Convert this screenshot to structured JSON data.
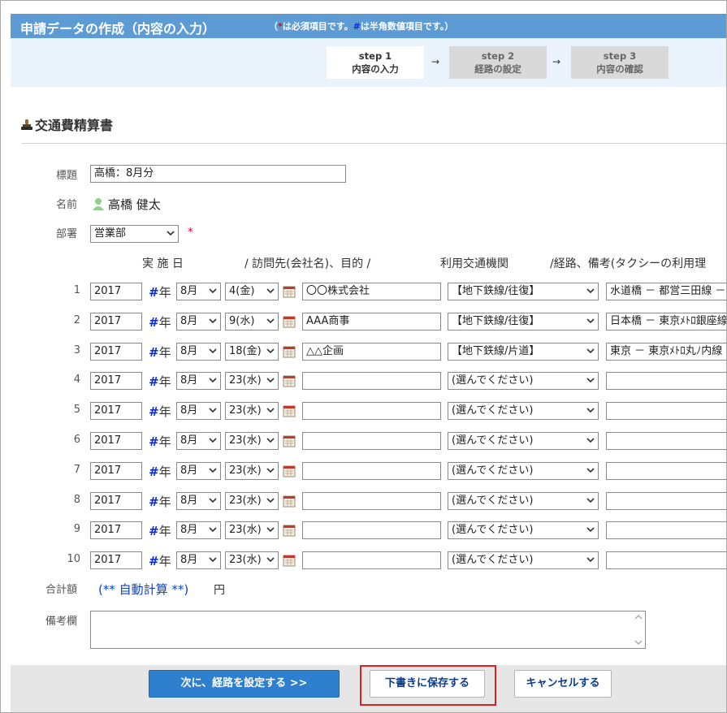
{
  "header": {
    "title": "申請データの作成（内容の入力）",
    "note_open": "（",
    "note_red_mark": "*",
    "note_mid": "は必須項目です。",
    "note_blue_mark": "#",
    "note_end": "は半角数値項目です。）"
  },
  "steps": [
    {
      "label": "step 1",
      "sub": "内容の入力",
      "active": true
    },
    {
      "label": "step 2",
      "sub": "経路の設定",
      "active": false
    },
    {
      "label": "step 3",
      "sub": "内容の確認",
      "active": false
    }
  ],
  "arrow_glyph": "→",
  "form_title": "交通費精算書",
  "fields": {
    "title_label": "標題",
    "title_value": "高橋：8月分",
    "name_label": "名前",
    "name_value": "高橋 健太",
    "dept_label": "部署",
    "dept_value": "営業部",
    "required_mark": "*"
  },
  "columns": {
    "date": "実 施 日",
    "visit": "/ 訪問先(会社名)、目的 /",
    "transport": "利用交通機関",
    "route": "/経路、備考(タクシーの利用理"
  },
  "rows": [
    {
      "num": "1",
      "year": "2017",
      "month": "8月",
      "day": "4(金)",
      "visit": "〇〇株式会社",
      "transport": "【地下鉄線/往復】",
      "route": "水道橋 － 都営三田線 －"
    },
    {
      "num": "2",
      "year": "2017",
      "month": "8月",
      "day": "9(水)",
      "visit": "AAA商事",
      "transport": "【地下鉄線/往復】",
      "route": "日本橋 － 東京ﾒﾄﾛ銀座線"
    },
    {
      "num": "3",
      "year": "2017",
      "month": "8月",
      "day": "18(金)",
      "visit": "△△企画",
      "transport": "【地下鉄線/片道】",
      "route": "東京 － 東京ﾒﾄﾛ丸ﾉ内線"
    },
    {
      "num": "4",
      "year": "2017",
      "month": "8月",
      "day": "23(水)",
      "visit": "",
      "transport": "(選んでください)",
      "route": ""
    },
    {
      "num": "5",
      "year": "2017",
      "month": "8月",
      "day": "23(水)",
      "visit": "",
      "transport": "(選んでください)",
      "route": ""
    },
    {
      "num": "6",
      "year": "2017",
      "month": "8月",
      "day": "23(水)",
      "visit": "",
      "transport": "(選んでください)",
      "route": ""
    },
    {
      "num": "7",
      "year": "2017",
      "month": "8月",
      "day": "23(水)",
      "visit": "",
      "transport": "(選んでください)",
      "route": ""
    },
    {
      "num": "8",
      "year": "2017",
      "month": "8月",
      "day": "23(水)",
      "visit": "",
      "transport": "(選んでください)",
      "route": ""
    },
    {
      "num": "9",
      "year": "2017",
      "month": "8月",
      "day": "23(水)",
      "visit": "",
      "transport": "(選んでください)",
      "route": ""
    },
    {
      "num": "10",
      "year": "2017",
      "month": "8月",
      "day": "23(水)",
      "visit": "",
      "transport": "(選んでください)",
      "route": ""
    }
  ],
  "year_hash": "#",
  "year_unit": "年",
  "summary": {
    "label": "合計額",
    "auto": "(** 自動計算 **)",
    "yen": "円"
  },
  "remarks_label": "備考欄",
  "buttons": {
    "next": "次に、経路を設定する >>",
    "draft": "下書きに保存する",
    "cancel": "キャンセルする"
  },
  "icons": {
    "form": "stamp-icon",
    "user": "user-icon",
    "calendar": "calendar-icon",
    "chevron": "chevron-down-icon"
  },
  "colors": {
    "header": "#5d9bd5",
    "primary_button": "#2f7fcf",
    "highlight": "#e02020",
    "required": "#e0001b",
    "numeric_mark": "#0c2bd8"
  }
}
